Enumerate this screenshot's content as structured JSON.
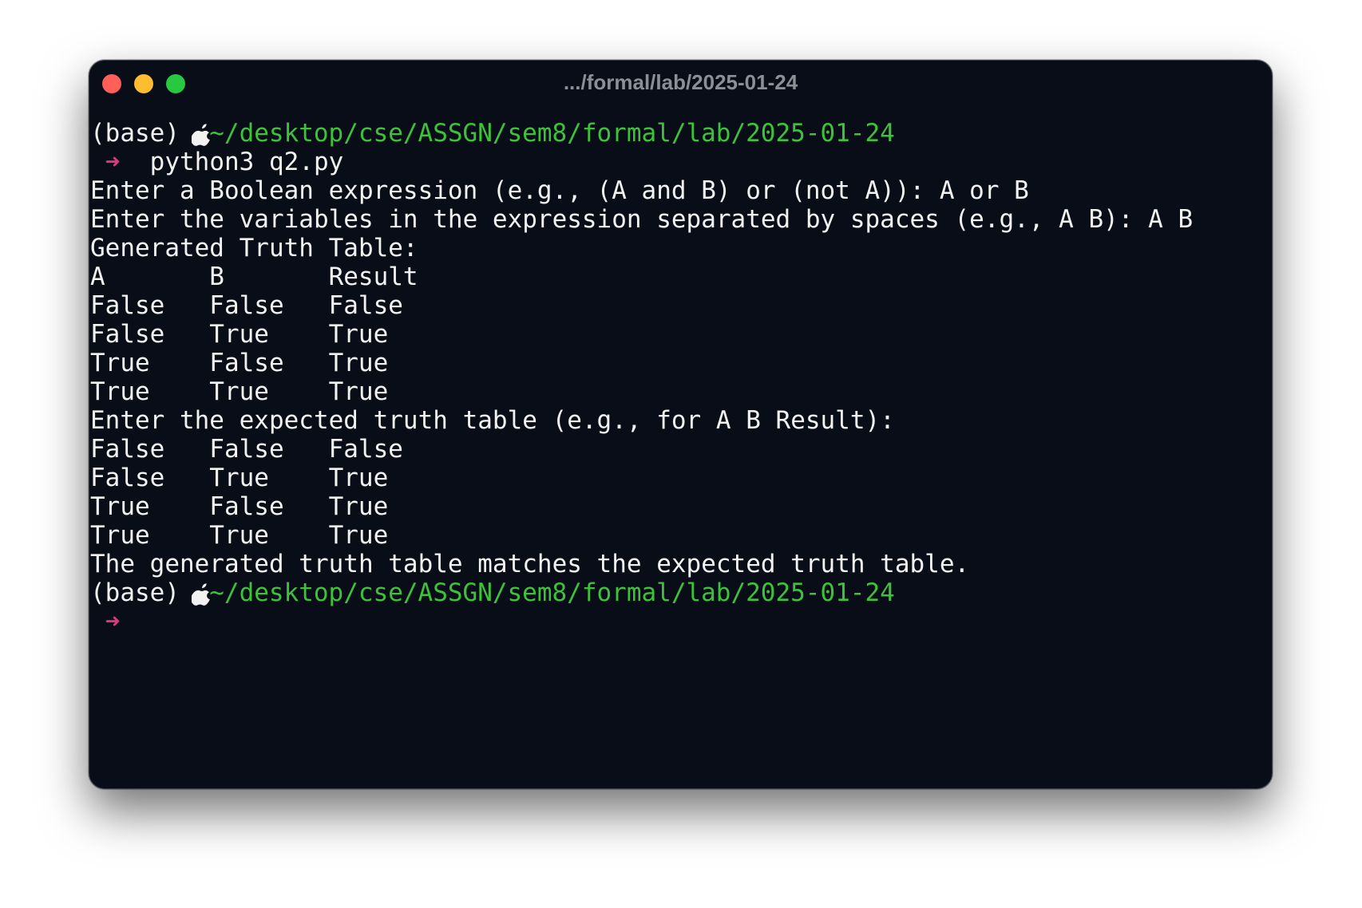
{
  "window": {
    "title": ".../formal/lab/2025-01-24"
  },
  "colors": {
    "background": "#090d18",
    "text": "#f2f2f2",
    "path": "#3ec23a",
    "arrow": "#e0357a",
    "close": "#fe5f57",
    "minimize": "#febc2e",
    "zoom": "#28c840"
  },
  "icons": {
    "prompt_logo": "apple-icon",
    "prompt_arrow": "arrow-icon"
  },
  "terminal": {
    "prompt1": {
      "env": "(base)",
      "path": "~/desktop/cse/ASSGN/sem8/formal/lab/2025-01-24",
      "arrow": "➜",
      "command": "python3 q2.py"
    },
    "lines": {
      "expr_prompt": "Enter a Boolean expression (e.g., (A and B) or (not A)): A or B",
      "vars_prompt": "Enter the variables in the expression separated by spaces (e.g., A B): A B",
      "generated_header": "Generated Truth Table:",
      "expected_prompt": "Enter the expected truth table (e.g., for A B Result):",
      "result_message": "The generated truth table matches the expected truth table."
    },
    "generated_table": {
      "headers": [
        "A",
        "B",
        "Result"
      ],
      "rows": [
        [
          "False",
          "False",
          "False"
        ],
        [
          "False",
          "True",
          "True"
        ],
        [
          "True",
          "False",
          "True"
        ],
        [
          "True",
          "True",
          "True"
        ]
      ]
    },
    "expected_table": {
      "rows": [
        [
          "False",
          "False",
          "False"
        ],
        [
          "False",
          "True",
          "True"
        ],
        [
          "True",
          "False",
          "True"
        ],
        [
          "True",
          "True",
          "True"
        ]
      ]
    },
    "prompt2": {
      "env": "(base)",
      "path": "~/desktop/cse/ASSGN/sem8/formal/lab/2025-01-24",
      "arrow": "➜"
    }
  }
}
